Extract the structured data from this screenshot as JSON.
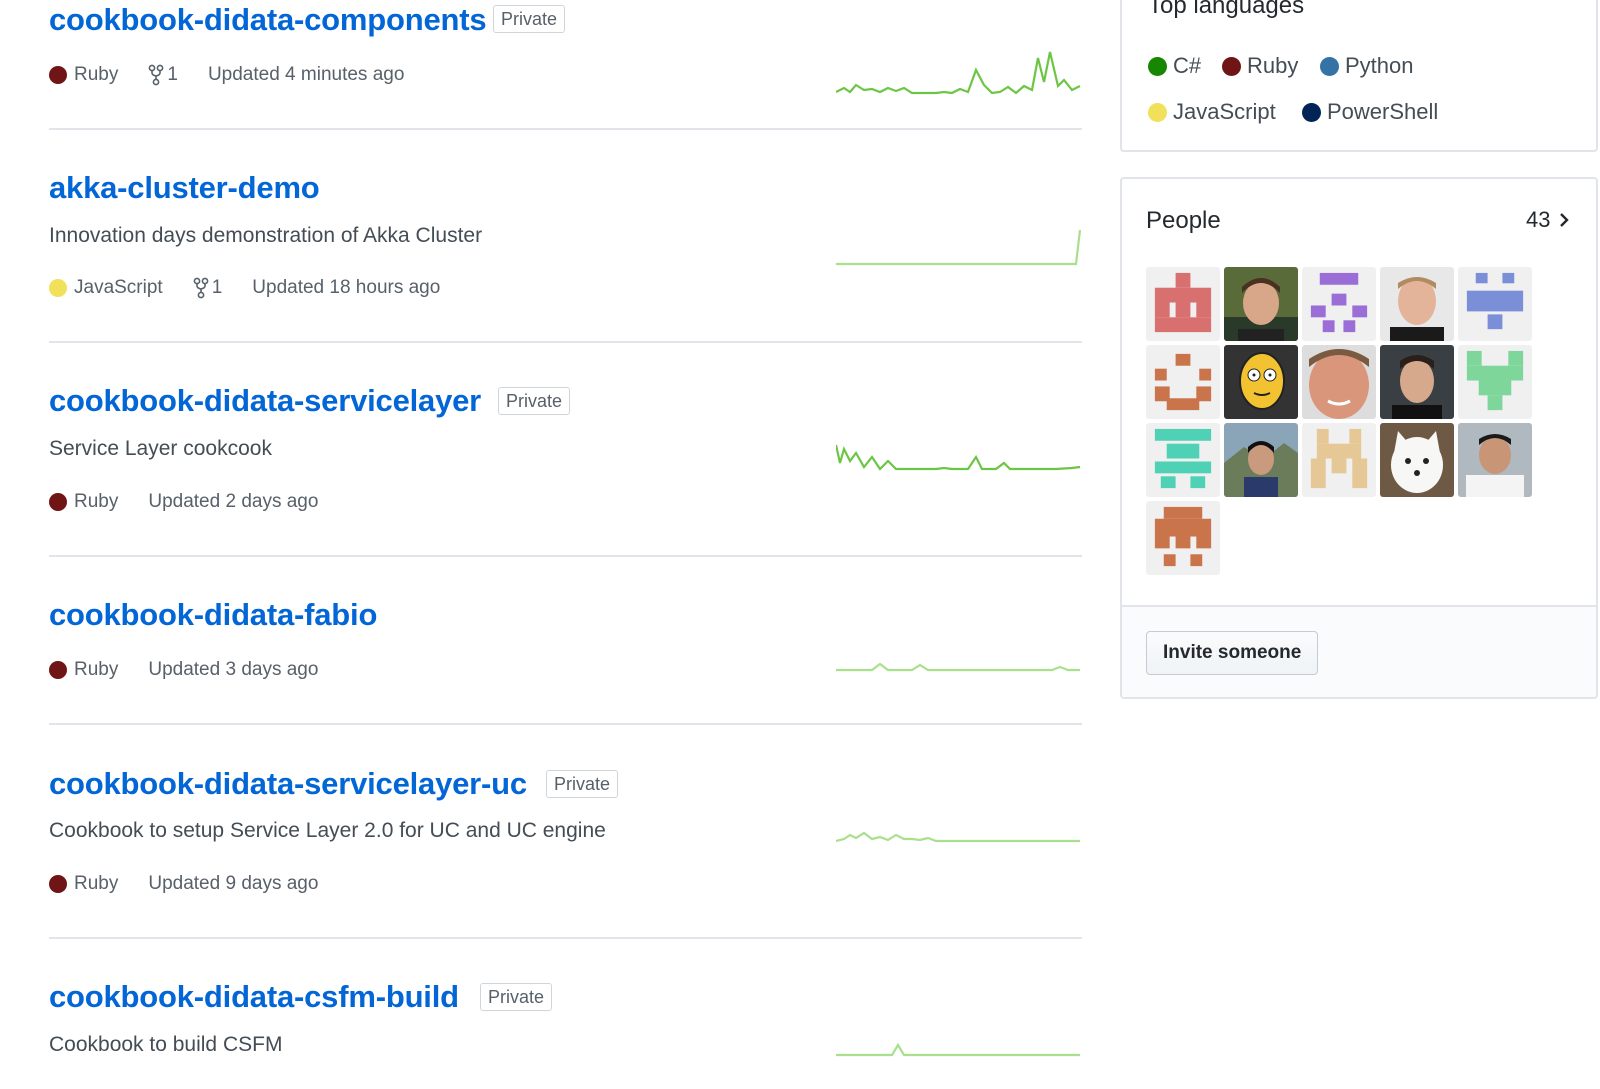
{
  "repos": [
    {
      "name": "cookbook-didata-components",
      "private": "Private",
      "description": "",
      "language": "Ruby",
      "language_color": "#701516",
      "forks": "1",
      "updated": "Updated 4 minutes ago"
    },
    {
      "name": "akka-cluster-demo",
      "private": "",
      "description": "Innovation days demonstration of Akka Cluster",
      "language": "JavaScript",
      "language_color": "#f1e05a",
      "forks": "1",
      "updated": "Updated 18 hours ago"
    },
    {
      "name": "cookbook-didata-servicelayer",
      "private": "Private",
      "description": "Service Layer cookcook",
      "language": "Ruby",
      "language_color": "#701516",
      "forks": "",
      "updated": "Updated 2 days ago"
    },
    {
      "name": "cookbook-didata-fabio",
      "private": "",
      "description": "",
      "language": "Ruby",
      "language_color": "#701516",
      "forks": "",
      "updated": "Updated 3 days ago"
    },
    {
      "name": "cookbook-didata-servicelayer-uc",
      "private": "Private",
      "description": "Cookbook to setup Service Layer 2.0 for UC and UC engine",
      "language": "Ruby",
      "language_color": "#701516",
      "forks": "",
      "updated": "Updated 9 days ago"
    },
    {
      "name": "cookbook-didata-csfm-build",
      "private": "Private",
      "description": "Cookbook to build CSFM",
      "language": "",
      "language_color": "",
      "forks": "",
      "updated": ""
    }
  ],
  "top_languages": {
    "title": "Top languages",
    "items": [
      {
        "name": "C#",
        "color": "#178600"
      },
      {
        "name": "Ruby",
        "color": "#701516"
      },
      {
        "name": "Python",
        "color": "#3572A5"
      },
      {
        "name": "JavaScript",
        "color": "#f1e05a"
      },
      {
        "name": "PowerShell",
        "color": "#012456"
      }
    ]
  },
  "people": {
    "title": "People",
    "count": "43",
    "invite_label": "Invite someone"
  }
}
